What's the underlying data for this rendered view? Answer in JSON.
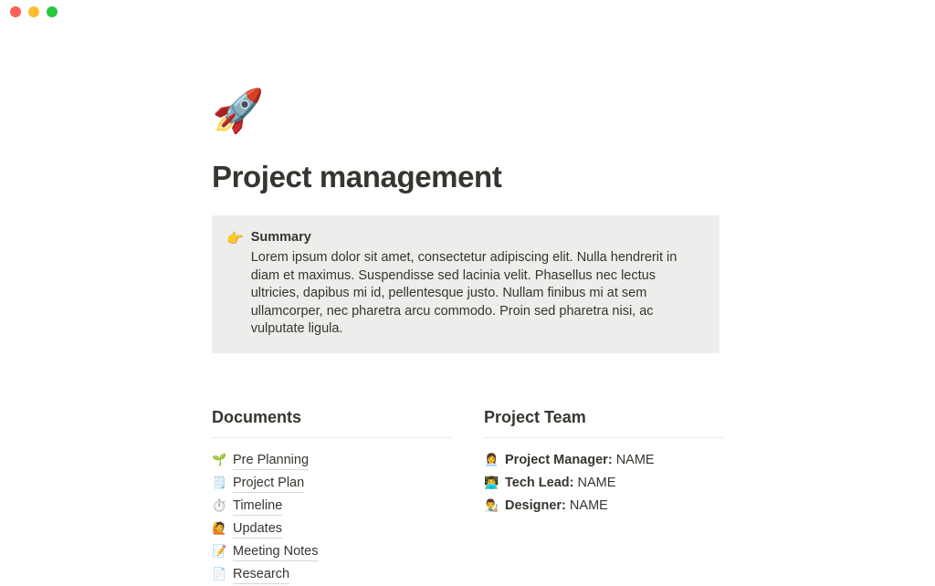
{
  "window": {
    "traffic_lights": [
      {
        "name": "close",
        "color": "#FF5F57"
      },
      {
        "name": "minimize",
        "color": "#FEBC2E"
      },
      {
        "name": "maximize",
        "color": "#28C840"
      }
    ]
  },
  "page": {
    "icon": "🚀",
    "icon_name": "rocket-emoji",
    "title": "Project management"
  },
  "callout": {
    "icon": "👉",
    "icon_name": "pointing-right-hand-emoji",
    "heading": "Summary",
    "text": "Lorem ipsum dolor sit amet, consectetur adipiscing elit. Nulla hendrerit in diam et maximus. Suspendisse sed lacinia velit. Phasellus nec lectus ultricies, dapibus mi id, pellentesque justo. Nullam finibus mi at sem ullamcorper, nec pharetra arcu commodo. Proin sed pharetra nisi, ac vulputate ligula.",
    "background_color": "#EDEDEB"
  },
  "documents": {
    "heading": "Documents",
    "items": [
      {
        "icon": "🌱",
        "icon_name": "seedling-emoji",
        "label": "Pre Planning"
      },
      {
        "icon": "🗒️",
        "icon_name": "spiral-notepad-emoji",
        "label": "Project Plan"
      },
      {
        "icon": "⏱️",
        "icon_name": "stopwatch-emoji",
        "label": "Timeline"
      },
      {
        "icon": "🙋",
        "icon_name": "raising-hand-emoji",
        "label": "Updates"
      },
      {
        "icon": "📝",
        "icon_name": "memo-emoji",
        "label": "Meeting Notes"
      },
      {
        "icon": "📄",
        "icon_name": "page-facing-up-emoji",
        "label": "Research"
      }
    ]
  },
  "project_team": {
    "heading": "Project Team",
    "members": [
      {
        "icon": "👩‍💼",
        "icon_name": "woman-office-worker-emoji",
        "role": "Project Manager:",
        "name": "NAME"
      },
      {
        "icon": "👨‍💻",
        "icon_name": "man-technologist-emoji",
        "role": "Tech Lead:",
        "name": "NAME"
      },
      {
        "icon": "👨‍🎨",
        "icon_name": "man-artist-emoji",
        "role": "Designer:",
        "name": "NAME"
      }
    ]
  }
}
